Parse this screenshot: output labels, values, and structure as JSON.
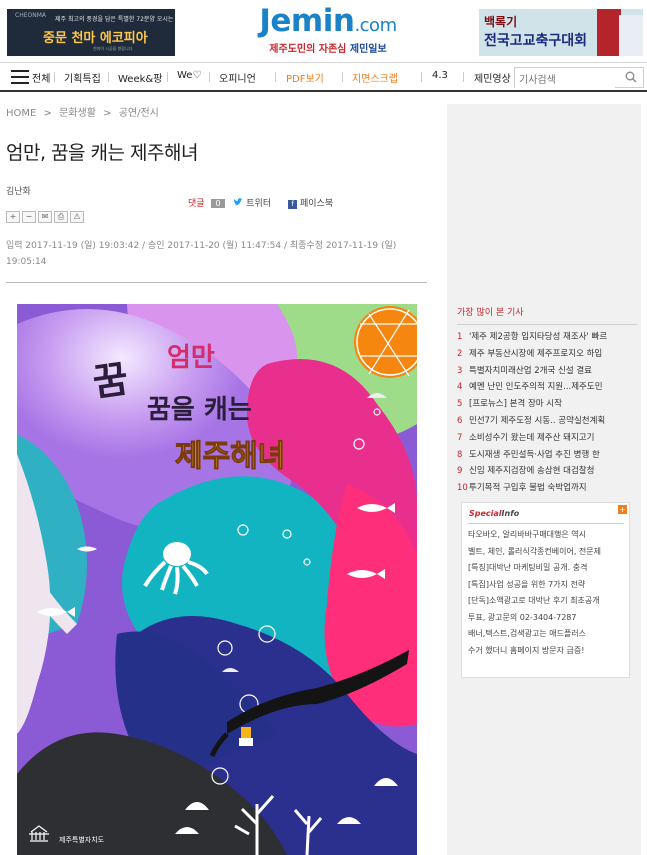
{
  "ads": {
    "left": {
      "brand": "CHEONMA",
      "tagline": "제주 최고의 풍경을 담은 특별한 72분양 오시는",
      "headline": "중문 천마 에코피아",
      "fine": "천마이 시공을 향합니다"
    },
    "right": {
      "line1": "백록기",
      "line2": "전국고교축구대회"
    }
  },
  "logo": {
    "word": "Jemin",
    "domain": ".com",
    "tagline_red": "제주도민의 자존심",
    "tagline_blue": "제민일보"
  },
  "nav": {
    "items": [
      "전체",
      "기획특집",
      "Week&팡",
      "We♡",
      "오피니언",
      "PDF보기",
      "지면스크랩",
      "4.3",
      "제민영상"
    ],
    "search_placeholder": "기사검색"
  },
  "breadcrumb": [
    "HOME",
    ">",
    "문화생활",
    ">",
    "공연/전시"
  ],
  "article": {
    "title": "엄만, 꿈을 캐는 제주해녀",
    "author": "김난화",
    "comment_label": "댓글",
    "comment_count": "0",
    "twitter_label": "트위터",
    "facebook_label": "페이스북",
    "tools": [
      "+",
      "−",
      "✉",
      "⎙",
      "⚠"
    ],
    "dates": "입력 2017-11-19 (일) 19:03:42 / 승인 2017-11-20 (월) 11:47:54 / 최종수정 2017-11-19 (일) 19:05:14"
  },
  "poster": {
    "title_small": "엄만",
    "title_big": "꿈을 캐는",
    "title_haenyeo": "제주해녀",
    "org": "제주특별자치도"
  },
  "colors": {
    "accent_red": "#c6262e",
    "logo_blue": "#1a83c8",
    "nav_orange": "#f07e1b"
  },
  "sidebar": {
    "popular_title": "가장 많이 본 기사",
    "popular": [
      {
        "n": "1",
        "t": "'제주 제2공항 입지타당성 재조사' 빠르"
      },
      {
        "n": "2",
        "t": "제주 부동산시장에 제주프로지오 하입"
      },
      {
        "n": "3",
        "t": "특별자치미래산업 2개국 신설 결료"
      },
      {
        "n": "4",
        "t": "예멘 난민 인도주의적 지원...제주도민"
      },
      {
        "n": "5",
        "t": "[프로뉴스] 본격 장마 시작"
      },
      {
        "n": "6",
        "t": "민선7기 제주도정 시동.. 공약실천계획"
      },
      {
        "n": "7",
        "t": "소비성수기 왔는데 제주산 돼지고기"
      },
      {
        "n": "8",
        "t": "도시재생 주민설득·사업 추진 병행 한"
      },
      {
        "n": "9",
        "t": "신임 제주지검장에 송삼현 대검찰청"
      },
      {
        "n": "10",
        "t": "투기목적 구입후 불법 숙박업까지"
      }
    ],
    "special": {
      "title_a": "Special",
      "title_b": "Info",
      "more": "+",
      "items": [
        "타오바오, 알리바바구매대행은 역시",
        "벨트, 체인, 롤러식각종컨베이어, 전문제",
        "[특징]대박난 마케팅비밀 공개. 충격",
        "[특집]사업 성공을 위한 7가지 전략",
        "[단독]소액광고로 대박난 후기 최초공개",
        "투표, 광고문의 02-3404-7287",
        "배너,텍스트,검색광고는 애드플러스",
        "수거 했더니 홈페이지 방문자 급증!"
      ]
    }
  }
}
